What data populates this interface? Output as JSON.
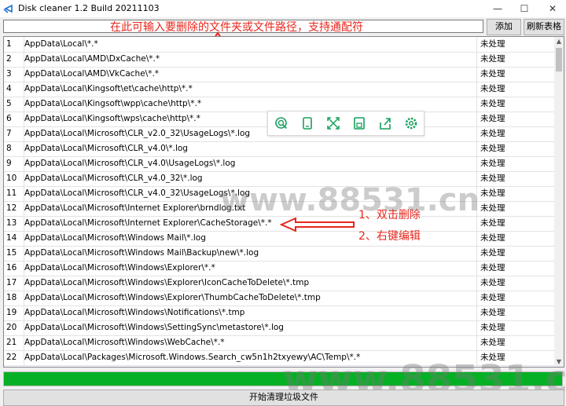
{
  "window": {
    "title": "Disk cleaner 1.2 Build 20211103",
    "minimize": "—",
    "maximize": "☐",
    "close": "✕"
  },
  "input": {
    "value": "",
    "hint": "在此可输入要删除的文件夹或文件路径，支持通配符",
    "add_label": "添加",
    "refresh_label": "刷新表格"
  },
  "rows": [
    {
      "num": "1",
      "path": "AppData\\Local\\*.*",
      "status": "未处理"
    },
    {
      "num": "2",
      "path": "AppData\\Local\\AMD\\DxCache\\*.*",
      "status": "未处理"
    },
    {
      "num": "3",
      "path": "AppData\\Local\\AMD\\VkCache\\*.*",
      "status": "未处理"
    },
    {
      "num": "4",
      "path": "AppData\\Local\\Kingsoft\\et\\cache\\http\\*.*",
      "status": "未处理"
    },
    {
      "num": "5",
      "path": "AppData\\Local\\Kingsoft\\wpp\\cache\\http\\*.*",
      "status": "未处理"
    },
    {
      "num": "6",
      "path": "AppData\\Local\\Kingsoft\\wps\\cache\\http\\*.*",
      "status": "未处理"
    },
    {
      "num": "7",
      "path": "AppData\\Local\\Microsoft\\CLR_v2.0_32\\UsageLogs\\*.log",
      "status": "未处理"
    },
    {
      "num": "8",
      "path": "AppData\\Local\\Microsoft\\CLR_v4.0\\*.log",
      "status": "未处理"
    },
    {
      "num": "9",
      "path": "AppData\\Local\\Microsoft\\CLR_v4.0\\UsageLogs\\*.log",
      "status": "未处理"
    },
    {
      "num": "10",
      "path": "AppData\\Local\\Microsoft\\CLR_v4.0_32\\*.log",
      "status": "未处理"
    },
    {
      "num": "11",
      "path": "AppData\\Local\\Microsoft\\CLR_v4.0_32\\UsageLogs\\*.log",
      "status": "未处理"
    },
    {
      "num": "12",
      "path": "AppData\\Local\\Microsoft\\Internet Explorer\\brndlog.txt",
      "status": "未处理"
    },
    {
      "num": "13",
      "path": "AppData\\Local\\Microsoft\\Internet Explorer\\CacheStorage\\*.*",
      "status": "未处理"
    },
    {
      "num": "14",
      "path": "AppData\\Local\\Microsoft\\Windows Mail\\*.log",
      "status": "未处理"
    },
    {
      "num": "15",
      "path": "AppData\\Local\\Microsoft\\Windows Mail\\Backup\\new\\*.log",
      "status": "未处理"
    },
    {
      "num": "16",
      "path": "AppData\\Local\\Microsoft\\Windows\\Explorer\\*.*",
      "status": "未处理"
    },
    {
      "num": "17",
      "path": "AppData\\Local\\Microsoft\\Windows\\Explorer\\IconCacheToDelete\\*.tmp",
      "status": "未处理"
    },
    {
      "num": "18",
      "path": "AppData\\Local\\Microsoft\\Windows\\Explorer\\ThumbCacheToDelete\\*.tmp",
      "status": "未处理"
    },
    {
      "num": "19",
      "path": "AppData\\Local\\Microsoft\\Windows\\Notifications\\*.tmp",
      "status": "未处理"
    },
    {
      "num": "20",
      "path": "AppData\\Local\\Microsoft\\Windows\\SettingSync\\metastore\\*.log",
      "status": "未处理"
    },
    {
      "num": "21",
      "path": "AppData\\Local\\Microsoft\\Windows\\WebCache\\*.*",
      "status": "未处理"
    },
    {
      "num": "22",
      "path": "AppData\\Local\\Packages\\Microsoft.Windows.Search_cw5n1h2txyewy\\AC\\Temp\\*.*",
      "status": "未处理"
    }
  ],
  "annotations": {
    "line1": "1、双击删除",
    "line2": "2、右键编辑"
  },
  "progress": {
    "value": 1.0
  },
  "start_button": "开始清理垃圾文件",
  "toolbar": {
    "icons": [
      "search-icon",
      "device-icon",
      "expand-icon",
      "save-icon",
      "share-icon",
      "settings-icon"
    ]
  },
  "watermark": "www.88531.cn",
  "colors": {
    "progress": "#06b025",
    "annotation": "#e8261c"
  }
}
